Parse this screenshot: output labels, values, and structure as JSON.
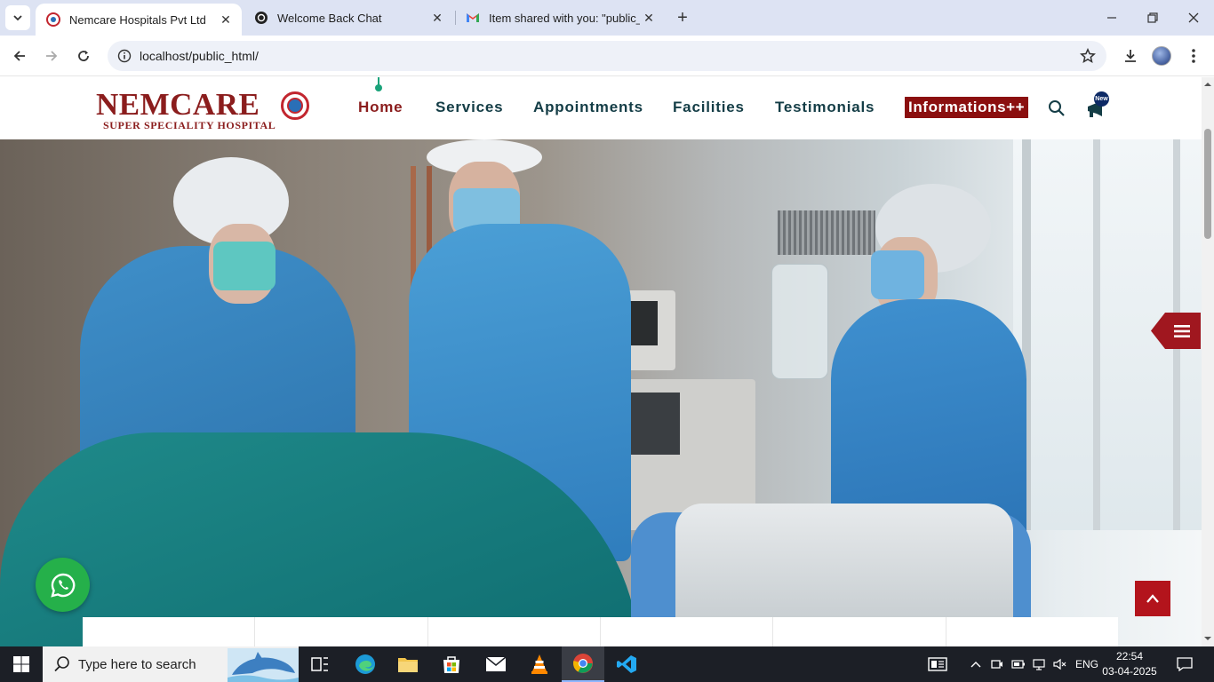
{
  "browser": {
    "tabs": [
      {
        "title": "Nemcare Hospitals Pvt Ltd",
        "active": true
      },
      {
        "title": "Welcome Back Chat",
        "active": false
      },
      {
        "title": "Item shared with you: \"public_h",
        "active": false
      }
    ],
    "url": "localhost/public_html/"
  },
  "site": {
    "logo": {
      "name": "NEMCARE",
      "tagline": "SUPER SPECIALITY HOSPITAL"
    },
    "nav": [
      {
        "label": "Home",
        "active": true
      },
      {
        "label": "Services"
      },
      {
        "label": "Appointments"
      },
      {
        "label": "Facilities"
      },
      {
        "label": "Testimonials"
      }
    ],
    "info_button": "Informations++",
    "new_badge": "New",
    "colors": {
      "brand": "#8b1d1d",
      "nav_text": "#143d46",
      "accent_green": "#1aa37a",
      "whatsapp": "#25b04a"
    }
  },
  "taskbar": {
    "search_placeholder": "Type here to search",
    "language": "ENG",
    "time": "22:54",
    "date": "03-04-2025"
  }
}
